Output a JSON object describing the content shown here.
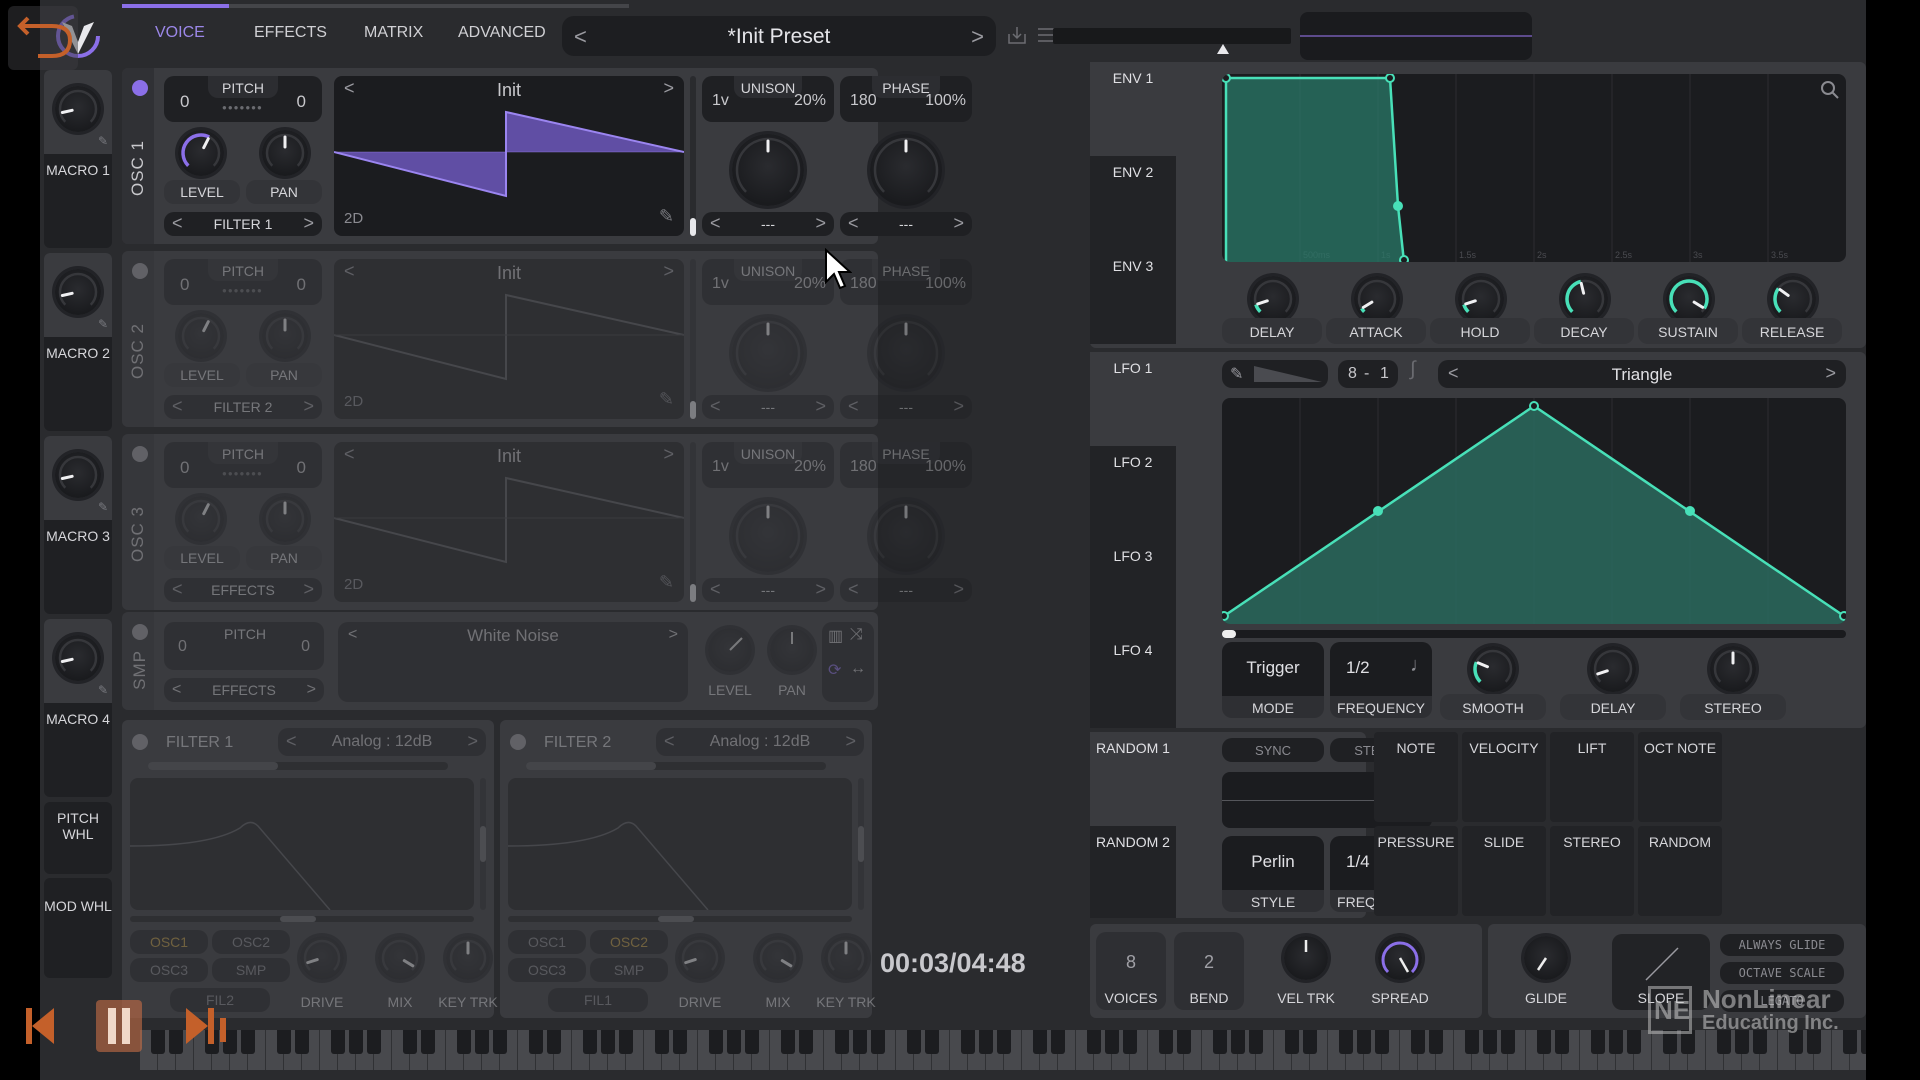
{
  "header": {
    "tabs": [
      {
        "label": "VOICE",
        "active": true
      },
      {
        "label": "EFFECTS",
        "active": false
      },
      {
        "label": "MATRIX",
        "active": false
      },
      {
        "label": "ADVANCED",
        "active": false
      }
    ],
    "preset_name": "*Init Preset",
    "prev_label": "<",
    "next_label": ">"
  },
  "macros": [
    {
      "label": "MACRO 1"
    },
    {
      "label": "MACRO 2"
    },
    {
      "label": "MACRO 3"
    },
    {
      "label": "MACRO 4"
    }
  ],
  "wheels": {
    "pitch": "PITCH WHL",
    "mod": "MOD WHL"
  },
  "oscillators": [
    {
      "name": "OSC 1",
      "enabled": true,
      "pitch_label": "PITCH",
      "pitch_left": "0",
      "pitch_right": "0",
      "level_label": "LEVEL",
      "pan_label": "PAN",
      "destination": "FILTER 1",
      "wavetable": "Init",
      "mode": "2D",
      "unison_label": "UNISON",
      "unison_voices": "1v",
      "unison_detune": "20%",
      "phase_label": "PHASE",
      "phase_value": "180",
      "phase_random": "100%",
      "spectral_1": "---",
      "spectral_2": "---"
    },
    {
      "name": "OSC 2",
      "enabled": false,
      "pitch_label": "PITCH",
      "pitch_left": "0",
      "pitch_right": "0",
      "level_label": "LEVEL",
      "pan_label": "PAN",
      "destination": "FILTER 2",
      "wavetable": "Init",
      "mode": "2D",
      "unison_label": "UNISON",
      "unison_voices": "1v",
      "unison_detune": "20%",
      "phase_label": "PHASE",
      "phase_value": "180",
      "phase_random": "100%",
      "spectral_1": "---",
      "spectral_2": "---"
    },
    {
      "name": "OSC 3",
      "enabled": false,
      "pitch_label": "PITCH",
      "pitch_left": "0",
      "pitch_right": "0",
      "level_label": "LEVEL",
      "pan_label": "PAN",
      "destination": "EFFECTS",
      "wavetable": "Init",
      "mode": "2D",
      "unison_label": "UNISON",
      "unison_voices": "1v",
      "unison_detune": "20%",
      "phase_label": "PHASE",
      "phase_value": "180",
      "phase_random": "100%",
      "spectral_1": "---",
      "spectral_2": "---"
    }
  ],
  "sample": {
    "name": "SMP",
    "pitch_label": "PITCH",
    "pitch_left": "0",
    "pitch_right": "0",
    "destination": "EFFECTS",
    "sample_name": "White Noise",
    "level_label": "LEVEL",
    "pan_label": "PAN"
  },
  "filters": [
    {
      "name": "FILTER 1",
      "model": "Analog : 12dB",
      "sources": [
        "OSC1",
        "OSC2",
        "OSC3",
        "SMP"
      ],
      "route": "FIL2",
      "drive_label": "DRIVE",
      "mix_label": "MIX",
      "keytrk_label": "KEY TRK"
    },
    {
      "name": "FILTER 2",
      "model": "Analog : 12dB",
      "sources": [
        "OSC1",
        "OSC2",
        "OSC3",
        "SMP"
      ],
      "route": "FIL1",
      "drive_label": "DRIVE",
      "mix_label": "MIX",
      "keytrk_label": "KEY TRK"
    }
  ],
  "envelopes": {
    "tabs": [
      "ENV 1",
      "ENV 2",
      "ENV 3"
    ],
    "active": 0,
    "time_labels": [
      "500ms",
      "1s",
      "1.5s",
      "2s",
      "2.5s",
      "3s",
      "3.5s"
    ],
    "knobs": [
      {
        "label": "DELAY",
        "value": 0.1
      },
      {
        "label": "ATTACK",
        "value": 0.05
      },
      {
        "label": "HOLD",
        "value": 0.1
      },
      {
        "label": "DECAY",
        "value": 0.45
      },
      {
        "label": "SUSTAIN",
        "value": 0.95
      },
      {
        "label": "RELEASE",
        "value": 0.3
      }
    ]
  },
  "lfos": {
    "tabs": [
      "LFO 1",
      "LFO 2",
      "LFO 3",
      "LFO 4"
    ],
    "active": 0,
    "grid": "8 - 1",
    "grid_x": "8",
    "grid_sep": "-",
    "grid_y": "1",
    "shape": "Triangle",
    "mode_value": "Trigger",
    "mode_label": "MODE",
    "frequency_value": "1/2",
    "frequency_label": "FREQUENCY",
    "knobs": [
      {
        "label": "SMOOTH",
        "value": 0.25
      },
      {
        "label": "DELAY",
        "value": 0.1
      },
      {
        "label": "STEREO",
        "value": 0.5
      }
    ]
  },
  "randoms": {
    "tabs": [
      "RANDOM 1",
      "RANDOM 2"
    ],
    "sync_label": "SYNC",
    "stereo_label": "STEREO",
    "style_value": "Perlin",
    "style_label": "STYLE",
    "frequency_value": "1/4",
    "frequency_label": "FREQUENCY"
  },
  "mod_sources": [
    "NOTE",
    "VELOCITY",
    "LIFT",
    "OCT NOTE",
    "PRESSURE",
    "SLIDE",
    "STEREO",
    "RANDOM"
  ],
  "voice": {
    "voices_value": "8",
    "voices_label": "VOICES",
    "bend_value": "2",
    "bend_label": "BEND",
    "veltrk_label": "VEL TRK",
    "spread_label": "SPREAD",
    "glide_label": "GLIDE",
    "slope_label": "SLOPE",
    "always_glide": "ALWAYS GLIDE",
    "octave_scale": "OCTAVE SCALE",
    "legato": "LEGATO"
  },
  "video": {
    "timecode": "00:03/04:48"
  },
  "watermark": {
    "logo": "NE",
    "line1": "NonLinear",
    "line2": "Educating Inc."
  },
  "colors": {
    "accent": "#8b6fe8",
    "env": "#48e0b8",
    "lfo_fill": "#2a6a5e"
  }
}
